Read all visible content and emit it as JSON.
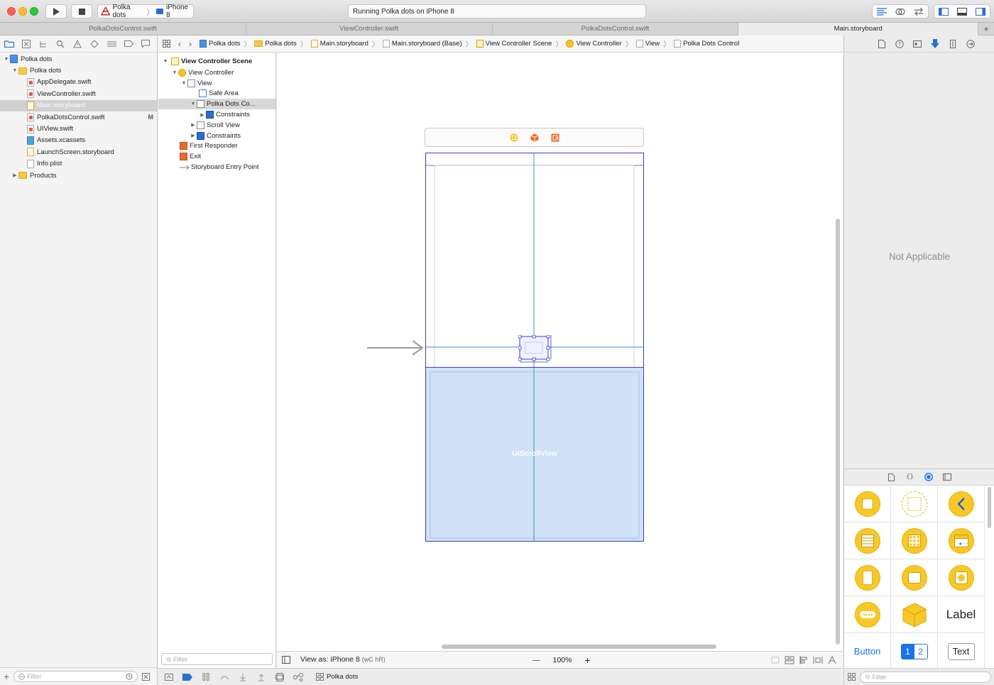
{
  "toolbar": {
    "scheme_project": "Polka dots",
    "scheme_device": "iPhone 8",
    "status_text": "Running Polka dots on iPhone 8"
  },
  "tabs": [
    {
      "label": "PolkaDotsControl.swift"
    },
    {
      "label": "ViewController.swift"
    },
    {
      "label": "PolkaDotsControl.swift"
    },
    {
      "label": "Main.storyboard"
    }
  ],
  "tab_add": "+",
  "navigator": {
    "items": [
      {
        "label": "Polka dots",
        "type": "project",
        "level": 0,
        "expanded": true
      },
      {
        "label": "Polka dots",
        "type": "folder",
        "level": 1,
        "expanded": true
      },
      {
        "label": "AppDelegate.swift",
        "type": "swift",
        "level": 2
      },
      {
        "label": "ViewController.swift",
        "type": "swift",
        "level": 2
      },
      {
        "label": "Main.storyboard",
        "type": "storyboard",
        "level": 2,
        "selected": true
      },
      {
        "label": "PolkaDotsControl.swift",
        "type": "swift",
        "level": 2,
        "badge": "M"
      },
      {
        "label": "UIView.swift",
        "type": "swift",
        "level": 2
      },
      {
        "label": "Assets.xcassets",
        "type": "assets",
        "level": 2
      },
      {
        "label": "LaunchScreen.storyboard",
        "type": "storyboard",
        "level": 2
      },
      {
        "label": "Info.plist",
        "type": "plist",
        "level": 2
      },
      {
        "label": "Products",
        "type": "folder",
        "level": 1,
        "expanded": false
      }
    ],
    "filter_placeholder": "Filter"
  },
  "jumpbar": {
    "items": [
      "Polka dots",
      "Polka dots",
      "Main.storyboard",
      "Main.storyboard (Base)",
      "View Controller Scene",
      "View Controller",
      "View",
      "Polka Dots Control"
    ]
  },
  "outline": {
    "items": [
      {
        "label": "View Controller Scene",
        "level": 0,
        "tri": "open",
        "icon": "scene",
        "bold": true
      },
      {
        "label": "View Controller",
        "level": 1,
        "tri": "open",
        "icon": "yel"
      },
      {
        "label": "View",
        "level": 2,
        "tri": "open",
        "icon": "view"
      },
      {
        "label": "Safe Area",
        "level": 3,
        "tri": "",
        "icon": "safe"
      },
      {
        "label": "Polka Dots Co...",
        "level": 3,
        "tri": "open",
        "icon": "view",
        "selected": true
      },
      {
        "label": "Constraints",
        "level": 4,
        "tri": "closed",
        "icon": "blue"
      },
      {
        "label": "Scroll View",
        "level": 3,
        "tri": "closed",
        "icon": "view"
      },
      {
        "label": "Constraints",
        "level": 3,
        "tri": "closed",
        "icon": "blue"
      },
      {
        "label": "First Responder",
        "level": 1,
        "tri": "",
        "icon": "orange"
      },
      {
        "label": "Exit",
        "level": 1,
        "tri": "",
        "icon": "orange"
      },
      {
        "label": "Storyboard Entry Point",
        "level": 1,
        "tri": "",
        "icon": "arrow"
      }
    ],
    "filter_placeholder": "Filter"
  },
  "canvas": {
    "scrollview_label": "UIScrollView"
  },
  "canvas_bottom": {
    "view_as": "View as: iPhone 8",
    "size_class": "(wC hR)",
    "zoom_out": "—",
    "zoom": "100%",
    "zoom_in": "+"
  },
  "debugbar": {
    "target": "Polka dots"
  },
  "inspector": {
    "message": "Not Applicable"
  },
  "library": {
    "label_item": "Label",
    "button_item": "Button",
    "segment_1": "1",
    "segment_2": "2",
    "textfield_item": "Text",
    "filter_placeholder": "Filter"
  },
  "colors": {
    "selection_blue": "#3c3ec0",
    "scrollview_fill": "#cfe2f7",
    "library_yellow": "#f8c829",
    "accent_blue": "#1a73e8"
  }
}
